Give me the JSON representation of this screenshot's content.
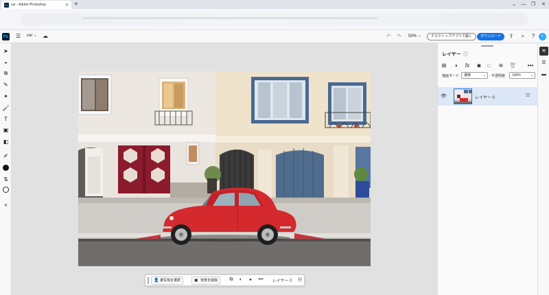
{
  "browser": {
    "tab_title": "car - Adobe Photoshop",
    "tab_close": "✕",
    "new_tab": "+",
    "window_controls": [
      "⌄",
      "—",
      "❐",
      "✕"
    ]
  },
  "header": {
    "logo": "Ps",
    "doc_name": "car",
    "zoom": "50%",
    "open_desktop": "デスクトップアプリで開く",
    "download": "ダウンロード",
    "icons": [
      "menu-icon",
      "cloud-icon",
      "undo-icon",
      "redo-icon",
      "share-icon",
      "search-icon",
      "help-icon",
      "avatar"
    ]
  },
  "tools": [
    "move-icon",
    "selection-icon",
    "crop-icon",
    "healing-icon",
    "magic-icon",
    "brush-icon",
    "type-icon",
    "shape-icon",
    "adjust-icon",
    "eyedropper-icon",
    "foreground-color",
    "swap-icon",
    "background-color",
    "collapse-icon"
  ],
  "taskbar": {
    "select_subject": "被写体を選択",
    "remove_background": "背景を削除",
    "layer": "レイヤー 0"
  },
  "panel": {
    "title": "レイヤー",
    "blend_label": "描画モード",
    "blend_value": "通常",
    "opacity_label": "不透明度",
    "opacity_value": "100%",
    "layers": [
      {
        "name": "レイヤー 0",
        "visible": true,
        "selected": true
      }
    ]
  },
  "colors": {
    "accent": "#1473e6",
    "ps_logo_bg": "#001e36",
    "ps_logo_fg": "#31a8ff",
    "car_red": "#d42a2e",
    "garage_red": "#8c1b2e"
  }
}
